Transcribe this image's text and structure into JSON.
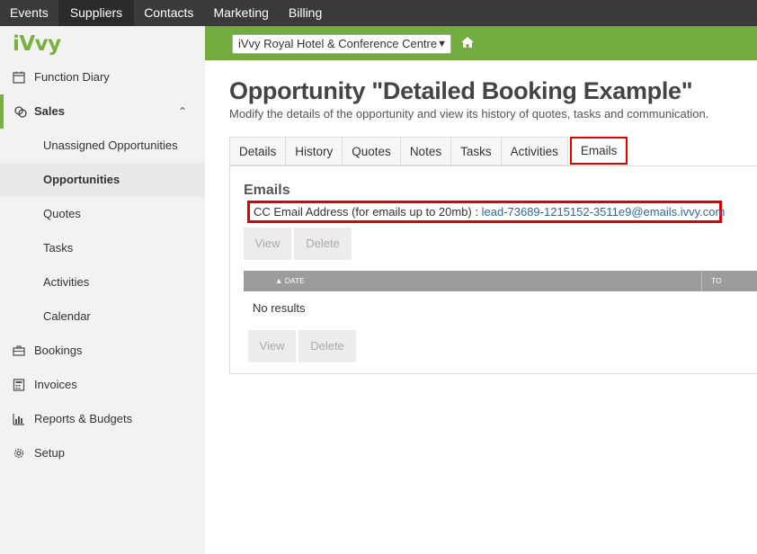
{
  "topnav": {
    "items": [
      "Events",
      "Suppliers",
      "Contacts",
      "Marketing",
      "Billing"
    ]
  },
  "brand": {
    "logo": "iVvy",
    "accent": "#72ac3e"
  },
  "sidebar": {
    "items": [
      {
        "label": "Function Diary",
        "icon": "calendar-icon"
      },
      {
        "label": "Sales",
        "icon": "sales-icon"
      },
      {
        "label": "Unassigned Opportunities"
      },
      {
        "label": "Opportunities"
      },
      {
        "label": "Quotes"
      },
      {
        "label": "Tasks"
      },
      {
        "label": "Activities"
      },
      {
        "label": "Calendar"
      },
      {
        "label": "Bookings",
        "icon": "briefcase-icon"
      },
      {
        "label": "Invoices",
        "icon": "calculator-icon"
      },
      {
        "label": "Reports & Budgets",
        "icon": "bar-chart-icon"
      },
      {
        "label": "Setup",
        "icon": "gear-icon"
      }
    ]
  },
  "venue": {
    "selected": "iVvy Royal Hotel & Conference Centre"
  },
  "page": {
    "title": "Opportunity \"Detailed Booking Example\"",
    "subtitle": "Modify the details of the opportunity and view its history of quotes, tasks and communication."
  },
  "tabs": [
    "Details",
    "History",
    "Quotes",
    "Notes",
    "Tasks",
    "Activities",
    "Emails"
  ],
  "emails": {
    "heading": "Emails",
    "cc_label": "CC Email Address (for emails up to 20mb) :",
    "cc_address": "lead-73689-1215152-3511e9@emails.ivvy.com",
    "view_label": "View",
    "delete_label": "Delete",
    "col_date": "DATE",
    "col_to": "TO",
    "no_results": "No results"
  }
}
